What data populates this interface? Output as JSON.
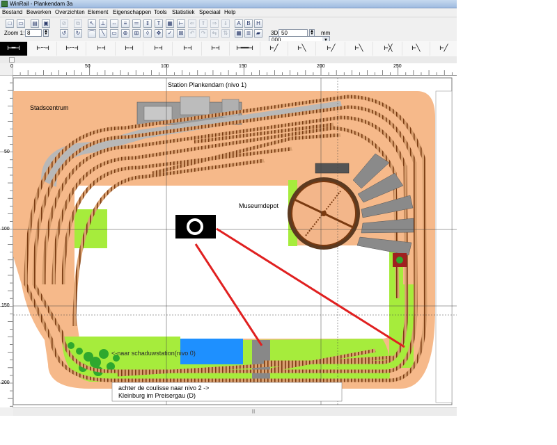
{
  "window": {
    "title": "WinRail - Plankendam 3a"
  },
  "menu": [
    "Bestand",
    "Bewerken",
    "Overzichten",
    "Element",
    "Eigenschappen",
    "Tools",
    "Statistiek",
    "Speciaal",
    "Help"
  ],
  "toolbar": {
    "zoom_label": "Zoom 1:",
    "zoom_value": "8",
    "layer_select": "000",
    "d3_label": "3D:",
    "d3_value": "50",
    "unit": "mm",
    "text_buttons": [
      "A",
      "B",
      "H"
    ]
  },
  "track_tools": [
    "turnout-straight",
    "straight",
    "straight-short",
    "straight-short",
    "straight-short",
    "straight-short",
    "straight-short",
    "straight-long",
    "turnout-left",
    "turnout-right",
    "turnout-curved",
    "turnout-curved",
    "turnout-double",
    "turnout-cross",
    "turnout-three"
  ],
  "ruler": {
    "h_labels": [
      "0",
      "50",
      "100",
      "150",
      "200",
      "250"
    ],
    "v_labels": [
      "50",
      "100",
      "150",
      "200"
    ]
  },
  "layout": {
    "title": "Station Plankendam (nivo 1)",
    "area_city": "Stadscentrum",
    "area_museum": "Museumdepot",
    "note_shadow": "<-naar schaduwstation(nivo 0)",
    "note_coulisse_1": "achter de coulisse  naar nivo 2 ->",
    "note_coulisse_2": "Kleinburg im Preisergau (D)"
  },
  "colors": {
    "baseboard": "#f6b98a",
    "grass": "#a6ec3c",
    "rail": "#7a3a10",
    "platform": "#b8b8b8",
    "water": "#1e90ff",
    "pointer": "#e02020"
  }
}
